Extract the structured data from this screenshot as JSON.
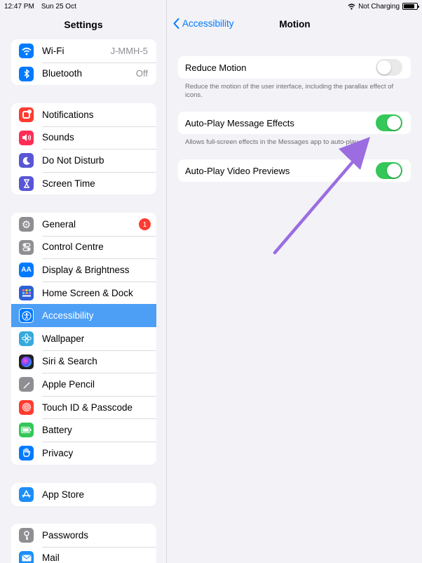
{
  "status": {
    "time": "12:47 PM",
    "date": "Sun 25 Oct",
    "charging": "Not Charging",
    "battery_level": 0.85
  },
  "sidebar": {
    "title": "Settings",
    "groups": [
      {
        "rows": [
          {
            "label": "Wi-Fi",
            "value": "J-MMH-5",
            "icon": "wifi-icon",
            "color": "#007aff"
          },
          {
            "label": "Bluetooth",
            "value": "Off",
            "icon": "bluetooth-icon",
            "color": "#007aff"
          }
        ]
      },
      {
        "rows": [
          {
            "label": "Notifications",
            "icon": "notifications-icon",
            "color": "#ff3b30"
          },
          {
            "label": "Sounds",
            "icon": "sounds-icon",
            "color": "#ff2d55"
          },
          {
            "label": "Do Not Disturb",
            "icon": "moon-icon",
            "color": "#5856d6"
          },
          {
            "label": "Screen Time",
            "icon": "hourglass-icon",
            "color": "#5856d6"
          }
        ]
      },
      {
        "rows": [
          {
            "label": "General",
            "icon": "gear-icon",
            "color": "#8e8e93",
            "badge": "1"
          },
          {
            "label": "Control Centre",
            "icon": "toggles-icon",
            "color": "#8e8e93"
          },
          {
            "label": "Display & Brightness",
            "icon": "display-icon",
            "color": "#007aff"
          },
          {
            "label": "Home Screen & Dock",
            "icon": "home-grid-icon",
            "color": "#2f5fd8"
          },
          {
            "label": "Accessibility",
            "icon": "accessibility-icon",
            "color": "#007aff",
            "selected": true
          },
          {
            "label": "Wallpaper",
            "icon": "wallpaper-flower-icon",
            "color": "#36aadc"
          },
          {
            "label": "Siri & Search",
            "icon": "siri-icon",
            "color": "#222"
          },
          {
            "label": "Apple Pencil",
            "icon": "pencil-icon",
            "color": "#8e8e93"
          },
          {
            "label": "Touch ID & Passcode",
            "icon": "fingerprint-icon",
            "color": "#ff3b30"
          },
          {
            "label": "Battery",
            "icon": "battery-icon",
            "color": "#34c759"
          },
          {
            "label": "Privacy",
            "icon": "hand-icon",
            "color": "#007aff"
          }
        ]
      },
      {
        "rows": [
          {
            "label": "App Store",
            "icon": "app-store-icon",
            "color": "#1c8ef9"
          }
        ]
      },
      {
        "rows": [
          {
            "label": "Passwords",
            "icon": "key-icon",
            "color": "#8e8e93"
          },
          {
            "label": "Mail",
            "icon": "mail-icon",
            "color": "#1c8ef9"
          }
        ]
      }
    ]
  },
  "main": {
    "back_label": "Accessibility",
    "title": "Motion",
    "settings": [
      {
        "label": "Reduce Motion",
        "on": false,
        "footer": "Reduce the motion of the user interface, including the parallax effect of icons."
      },
      {
        "label": "Auto-Play Message Effects",
        "on": true,
        "footer": "Allows full-screen effects in the Messages app to auto-play."
      },
      {
        "label": "Auto-Play Video Previews",
        "on": true,
        "footer": ""
      }
    ]
  },
  "colors": {
    "accent": "#007aff",
    "toggle_on": "#34c759",
    "selected_row": "#4c9ff5",
    "arrow": "#9b6de0"
  }
}
